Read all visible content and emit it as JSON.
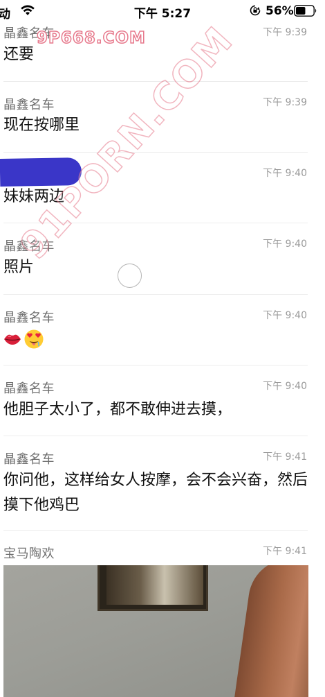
{
  "status_bar": {
    "carrier": "动",
    "time": "下午 5:27",
    "battery_percent": "56%",
    "battery_level": 0.56,
    "icons": [
      "wifi-icon",
      "rotation-lock-icon",
      "battery-icon"
    ]
  },
  "watermarks": {
    "top": "9P668.COM",
    "diagonal": "91PORN.COM"
  },
  "messages": [
    {
      "sender": "晶鑫名车",
      "time": "下午 9:39",
      "text": "还要"
    },
    {
      "sender": "晶鑫名车",
      "time": "下午 9:39",
      "text": "现在按哪里"
    },
    {
      "sender": "",
      "time": "下午 9:40",
      "text": "妹妹两边",
      "sender_redacted": true
    },
    {
      "sender": "晶鑫名车",
      "time": "下午 9:40",
      "text": "照片"
    },
    {
      "sender": "晶鑫名车",
      "time": "下午 9:40",
      "emojis": [
        "lips-emoji",
        "heart-eyes-drooling-emoji"
      ]
    },
    {
      "sender": "晶鑫名车",
      "time": "下午 9:40",
      "text": "他胆子太小了，都不敢伸进去摸，"
    },
    {
      "sender": "晶鑫名车",
      "time": "下午 9:41",
      "text": "你问他，这样给女人按摩，会不会兴奋，然后摸下他鸡巴"
    },
    {
      "sender": "宝马陶欢",
      "time": "下午 9:41",
      "attachment": "photo"
    }
  ],
  "colors": {
    "sender": "#6f6f6f",
    "time": "#9a9a9a",
    "text": "#111111",
    "redaction": "#3a36c8",
    "watermark_stroke": "#e77a8d"
  }
}
